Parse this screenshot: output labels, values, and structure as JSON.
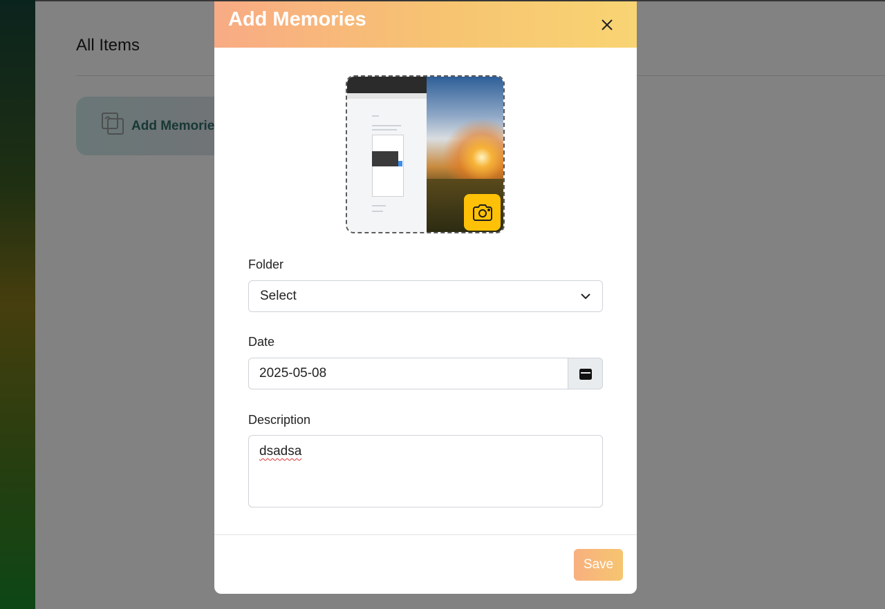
{
  "background": {
    "page_title": "All Items",
    "add_card_label": "Add Memorie"
  },
  "modal": {
    "title": "Add Memories",
    "photo": {
      "upload_icon": "camera-icon"
    },
    "folder": {
      "label": "Folder",
      "selected": "Select"
    },
    "date": {
      "label": "Date",
      "value": "2025-05-08"
    },
    "description": {
      "label": "Description",
      "value": "dsadsa"
    },
    "save_label": "Save"
  },
  "colors": {
    "header_gradient_start": "#f8ab84",
    "header_gradient_end": "#f8d473",
    "camera_button": "#ffc107",
    "save_button": "#f7b978"
  }
}
